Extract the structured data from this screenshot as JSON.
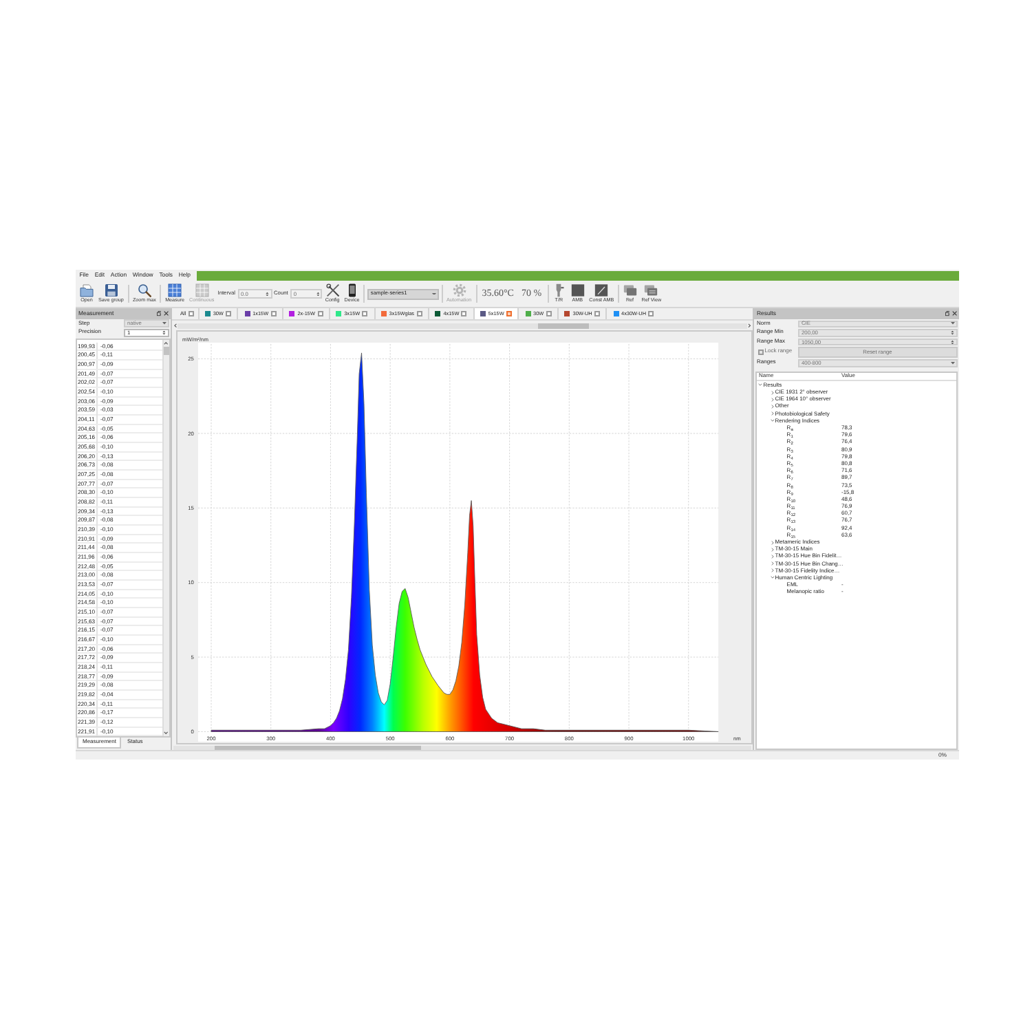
{
  "menu": [
    "File",
    "Edit",
    "Action",
    "Window",
    "Tools",
    "Help"
  ],
  "toolbar": {
    "groups": [
      [
        {
          "kind": "button",
          "label": "Open",
          "disabled": false
        },
        {
          "kind": "button",
          "label": "Save group",
          "disabled": false
        }
      ],
      [
        {
          "kind": "button",
          "label": "Zoom max",
          "disabled": false
        }
      ],
      [
        {
          "kind": "button",
          "label": "Measure",
          "disabled": false
        },
        {
          "kind": "button",
          "label": "Continuous",
          "disabled": true
        },
        {
          "kind": "spin",
          "label": "Interval",
          "value": "0.0",
          "disabled": true
        },
        {
          "kind": "spin",
          "label": "Count",
          "value": "0",
          "disabled": true
        },
        {
          "kind": "button",
          "label": "Config",
          "disabled": false
        },
        {
          "kind": "button",
          "label": "Device",
          "disabled": false
        }
      ],
      [
        {
          "kind": "select",
          "value": "sample-series1"
        }
      ],
      [
        {
          "kind": "button",
          "label": "Automation",
          "disabled": true
        }
      ],
      [
        {
          "kind": "readout",
          "text": "35.60°C"
        },
        {
          "kind": "readout",
          "text": "70 %"
        }
      ],
      [
        {
          "kind": "button",
          "label": "T/R",
          "disabled": false
        },
        {
          "kind": "button",
          "label": "AMB",
          "disabled": false
        },
        {
          "kind": "button",
          "label": "Const AMB",
          "disabled": false
        }
      ],
      [
        {
          "kind": "button",
          "label": "Ref",
          "disabled": false
        },
        {
          "kind": "button",
          "label": "Ref View",
          "disabled": false
        }
      ]
    ]
  },
  "measurement_panel": {
    "title": "Measurement",
    "fields": [
      {
        "kind": "select",
        "label": "Step",
        "value": "native",
        "disabled": true
      },
      {
        "kind": "spin",
        "label": "Precision",
        "value": "1",
        "disabled": false
      }
    ],
    "rows": [
      [
        "199,93",
        "-0,06"
      ],
      [
        "200,45",
        "-0,11"
      ],
      [
        "200,97",
        "-0,09"
      ],
      [
        "201,49",
        "-0,07"
      ],
      [
        "202,02",
        "-0,07"
      ],
      [
        "202,54",
        "-0,10"
      ],
      [
        "203,06",
        "-0,09"
      ],
      [
        "203,59",
        "-0,03"
      ],
      [
        "204,11",
        "-0,07"
      ],
      [
        "204,63",
        "-0,05"
      ],
      [
        "205,16",
        "-0,06"
      ],
      [
        "205,68",
        "-0,10"
      ],
      [
        "206,20",
        "-0,13"
      ],
      [
        "206,73",
        "-0,08"
      ],
      [
        "207,25",
        "-0,08"
      ],
      [
        "207,77",
        "-0,07"
      ],
      [
        "208,30",
        "-0,10"
      ],
      [
        "208,82",
        "-0,11"
      ],
      [
        "209,34",
        "-0,13"
      ],
      [
        "209,87",
        "-0,08"
      ],
      [
        "210,39",
        "-0,10"
      ],
      [
        "210,91",
        "-0,09"
      ],
      [
        "211,44",
        "-0,08"
      ],
      [
        "211,96",
        "-0,06"
      ],
      [
        "212,48",
        "-0,05"
      ],
      [
        "213,00",
        "-0,08"
      ],
      [
        "213,53",
        "-0,07"
      ],
      [
        "214,05",
        "-0,10"
      ],
      [
        "214,58",
        "-0,10"
      ],
      [
        "215,10",
        "-0,07"
      ],
      [
        "215,63",
        "-0,07"
      ],
      [
        "216,15",
        "-0,07"
      ],
      [
        "216,67",
        "-0,10"
      ],
      [
        "217,20",
        "-0,06"
      ],
      [
        "217,72",
        "-0,09"
      ],
      [
        "218,24",
        "-0,11"
      ],
      [
        "218,77",
        "-0,09"
      ],
      [
        "219,29",
        "-0,08"
      ],
      [
        "219,82",
        "-0,04"
      ],
      [
        "220,34",
        "-0,11"
      ],
      [
        "220,86",
        "-0,17"
      ],
      [
        "221,39",
        "-0,12"
      ],
      [
        "221,91",
        "-0,10"
      ]
    ],
    "tabs": [
      {
        "label": "Measurement",
        "selected": true
      },
      {
        "label": "Status",
        "selected": false
      }
    ]
  },
  "plot": {
    "legend": {
      "all": {
        "label": "All",
        "checked": false
      },
      "items": [
        {
          "label": "30W",
          "color": "#1b8a8f",
          "selected": false,
          "checked": false
        },
        {
          "label": "1x15W",
          "color": "#6a3ea8",
          "selected": false,
          "checked": false
        },
        {
          "label": "2x-15W",
          "color": "#b21fe0",
          "selected": false,
          "checked": false
        },
        {
          "label": "3x15W",
          "color": "#2fe88a",
          "selected": false,
          "checked": false
        },
        {
          "label": "3x15Wglas",
          "color": "#f26b3c",
          "selected": false,
          "checked": false
        },
        {
          "label": "4x15W",
          "color": "#0c5a36",
          "selected": false,
          "checked": false
        },
        {
          "label": "5x15W",
          "color": "#5b5a85",
          "selected": true,
          "checked": true
        },
        {
          "label": "30W",
          "color": "#4fae4a",
          "selected": false,
          "checked": false
        },
        {
          "label": "30W-UH",
          "color": "#b5472f",
          "selected": false,
          "checked": false
        },
        {
          "label": "4x30W-UH",
          "color": "#1e90f5",
          "selected": false,
          "checked": false
        }
      ]
    },
    "chart_data": {
      "type": "area",
      "xlabel": "nm",
      "ylabel": "mW/m²/nm",
      "grid": true,
      "x": [
        200,
        250,
        300,
        350,
        380,
        390,
        400,
        405,
        410,
        415,
        420,
        425,
        430,
        435,
        440,
        445,
        448,
        452,
        456,
        460,
        465,
        470,
        475,
        480,
        485,
        490,
        495,
        500,
        505,
        510,
        515,
        520,
        525,
        530,
        535,
        540,
        545,
        550,
        560,
        570,
        580,
        590,
        595,
        600,
        605,
        610,
        615,
        620,
        625,
        630,
        633,
        636,
        639,
        642,
        645,
        650,
        655,
        660,
        670,
        680,
        690,
        700,
        720,
        740,
        760,
        780,
        800,
        850,
        900,
        950,
        1000,
        1050
      ],
      "series": [
        {
          "color": "#5a5a5a",
          "values": [
            0.1,
            0.1,
            0.1,
            0.1,
            0.2,
            0.2,
            0.4,
            0.6,
            0.9,
            1.4,
            2.2,
            3.5,
            5.5,
            9,
            14,
            20,
            24,
            25.4,
            22,
            16,
            9.5,
            5.8,
            3.8,
            2.6,
            2,
            1.8,
            2.1,
            3.2,
            5,
            7,
            8.6,
            9.4,
            9.6,
            9,
            8,
            7,
            6.2,
            5.5,
            4.5,
            3.7,
            3.1,
            2.6,
            2.5,
            2.5,
            2.8,
            3.4,
            4.4,
            6,
            8.5,
            12,
            14.5,
            15.5,
            13.8,
            10,
            6.5,
            3.8,
            2.3,
            1.5,
            0.9,
            0.6,
            0.5,
            0.4,
            0.2,
            0.2,
            0.1,
            0.1,
            0.1,
            0.1,
            0.1,
            0.1,
            0.1,
            0
          ]
        }
      ],
      "xlim": [
        178,
        1050
      ],
      "ylim": [
        0,
        26
      ],
      "xticks": [
        200,
        300,
        400,
        500,
        600,
        700,
        800,
        900,
        1000
      ],
      "yticks": [
        0,
        5,
        10,
        15,
        20,
        25
      ]
    }
  },
  "results_panel": {
    "title": "Results",
    "fields": [
      {
        "kind": "select",
        "label": "Norm",
        "value": "CIE",
        "disabled": true
      },
      {
        "kind": "spin",
        "label": "Range Min",
        "value": "200,00",
        "disabled": true
      },
      {
        "kind": "spin",
        "label": "Range Max",
        "value": "1050,00",
        "disabled": true
      },
      {
        "kind": "check",
        "label": "Lock range",
        "checked": false,
        "disabled": true,
        "button": "Reset range"
      },
      {
        "kind": "select",
        "label": "Ranges",
        "value": "400-800",
        "disabled": true
      }
    ],
    "columns": [
      "Name",
      "Value"
    ],
    "tree": [
      {
        "name": "Results",
        "expanded": true,
        "children": [
          {
            "name": "CIE 1931 2° observer",
            "expanded": false
          },
          {
            "name": "CIE 1964 10° observer",
            "expanded": false
          },
          {
            "name": "Other",
            "expanded": false
          },
          {
            "name": "Photobiological Safety",
            "expanded": false
          },
          {
            "name": "Rendering Indices",
            "expanded": true,
            "children": [
              {
                "name": "R$_{a}$",
                "value": "78,3"
              },
              {
                "name": "R$_{1}$",
                "value": "79,6"
              },
              {
                "name": "R$_{2}$",
                "value": "76,4"
              },
              {
                "name": "R$_{3}$",
                "value": "80,9"
              },
              {
                "name": "R$_{4}$",
                "value": "79,8"
              },
              {
                "name": "R$_{5}$",
                "value": "80,8"
              },
              {
                "name": "R$_{6}$",
                "value": "71,6"
              },
              {
                "name": "R$_{7}$",
                "value": "89,7"
              },
              {
                "name": "R$_{8}$",
                "value": "73,5"
              },
              {
                "name": "R$_{9}$",
                "value": "-15,8"
              },
              {
                "name": "R$_{10}$",
                "value": "48,6"
              },
              {
                "name": "R$_{11}$",
                "value": "76,9"
              },
              {
                "name": "R$_{12}$",
                "value": "60,7"
              },
              {
                "name": "R$_{13}$",
                "value": "76,7"
              },
              {
                "name": "R$_{14}$",
                "value": "92,4"
              },
              {
                "name": "R$_{15}$",
                "value": "63,6"
              }
            ]
          },
          {
            "name": "Metameric Indices",
            "expanded": false
          },
          {
            "name": "TM-30-15 Main",
            "expanded": false
          },
          {
            "name": "TM-30-15 Hue Bin Fidelit…",
            "expanded": false
          },
          {
            "name": "TM-30-15 Hue Bin Chang…",
            "expanded": false
          },
          {
            "name": "TM-30-15 Fidelity Indice…",
            "expanded": false
          },
          {
            "name": "Human Centric Lighting",
            "expanded": true,
            "children": [
              {
                "name": "EML",
                "value": "-"
              },
              {
                "name": "Melanopic ratio",
                "value": "-"
              }
            ]
          }
        ]
      }
    ]
  },
  "status_bar": {
    "progress": "0%"
  }
}
